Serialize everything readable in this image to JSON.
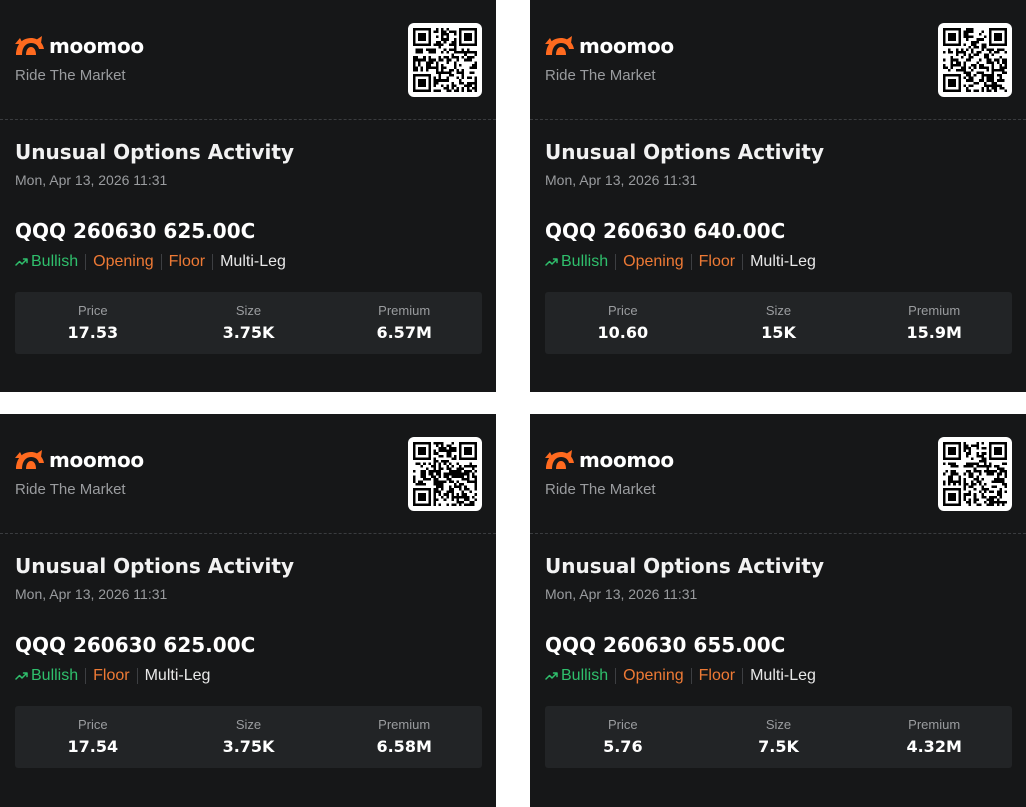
{
  "brand": {
    "name": "moomoo",
    "tagline": "Ride The Market",
    "logo_color": "#ff6a1f"
  },
  "colors": {
    "background": "#161718",
    "panel": "#222426",
    "bullish": "#2fbf6c",
    "tag_orange": "#ee7a35"
  },
  "cards": [
    {
      "title": "Unusual Options Activity",
      "timestamp": "Mon, Apr 13, 2026 11:31",
      "contract": "QQQ 260630 625.00C",
      "tags": [
        {
          "label": "Bullish",
          "tone": "green",
          "icon": "trend-up-icon"
        },
        {
          "label": "Opening",
          "tone": "orange"
        },
        {
          "label": "Floor",
          "tone": "orange"
        },
        {
          "label": "Multi-Leg",
          "tone": "white"
        }
      ],
      "stats": [
        {
          "label": "Price",
          "value": "17.53"
        },
        {
          "label": "Size",
          "value": "3.75K"
        },
        {
          "label": "Premium",
          "value": "6.57M"
        }
      ]
    },
    {
      "title": "Unusual Options Activity",
      "timestamp": "Mon, Apr 13, 2026 11:31",
      "contract": "QQQ 260630 640.00C",
      "tags": [
        {
          "label": "Bullish",
          "tone": "green",
          "icon": "trend-up-icon"
        },
        {
          "label": "Opening",
          "tone": "orange"
        },
        {
          "label": "Floor",
          "tone": "orange"
        },
        {
          "label": "Multi-Leg",
          "tone": "white"
        }
      ],
      "stats": [
        {
          "label": "Price",
          "value": "10.60"
        },
        {
          "label": "Size",
          "value": "15K"
        },
        {
          "label": "Premium",
          "value": "15.9M"
        }
      ]
    },
    {
      "title": "Unusual Options Activity",
      "timestamp": "Mon, Apr 13, 2026 11:31",
      "contract": "QQQ 260630 625.00C",
      "tags": [
        {
          "label": "Bullish",
          "tone": "green",
          "icon": "trend-up-icon"
        },
        {
          "label": "Floor",
          "tone": "orange"
        },
        {
          "label": "Multi-Leg",
          "tone": "white"
        }
      ],
      "stats": [
        {
          "label": "Price",
          "value": "17.54"
        },
        {
          "label": "Size",
          "value": "3.75K"
        },
        {
          "label": "Premium",
          "value": "6.58M"
        }
      ]
    },
    {
      "title": "Unusual Options Activity",
      "timestamp": "Mon, Apr 13, 2026 11:31",
      "contract": "QQQ 260630 655.00C",
      "tags": [
        {
          "label": "Bullish",
          "tone": "green",
          "icon": "trend-up-icon"
        },
        {
          "label": "Opening",
          "tone": "orange"
        },
        {
          "label": "Floor",
          "tone": "orange"
        },
        {
          "label": "Multi-Leg",
          "tone": "white"
        }
      ],
      "stats": [
        {
          "label": "Price",
          "value": "5.76"
        },
        {
          "label": "Size",
          "value": "7.5K"
        },
        {
          "label": "Premium",
          "value": "4.32M"
        }
      ]
    }
  ]
}
